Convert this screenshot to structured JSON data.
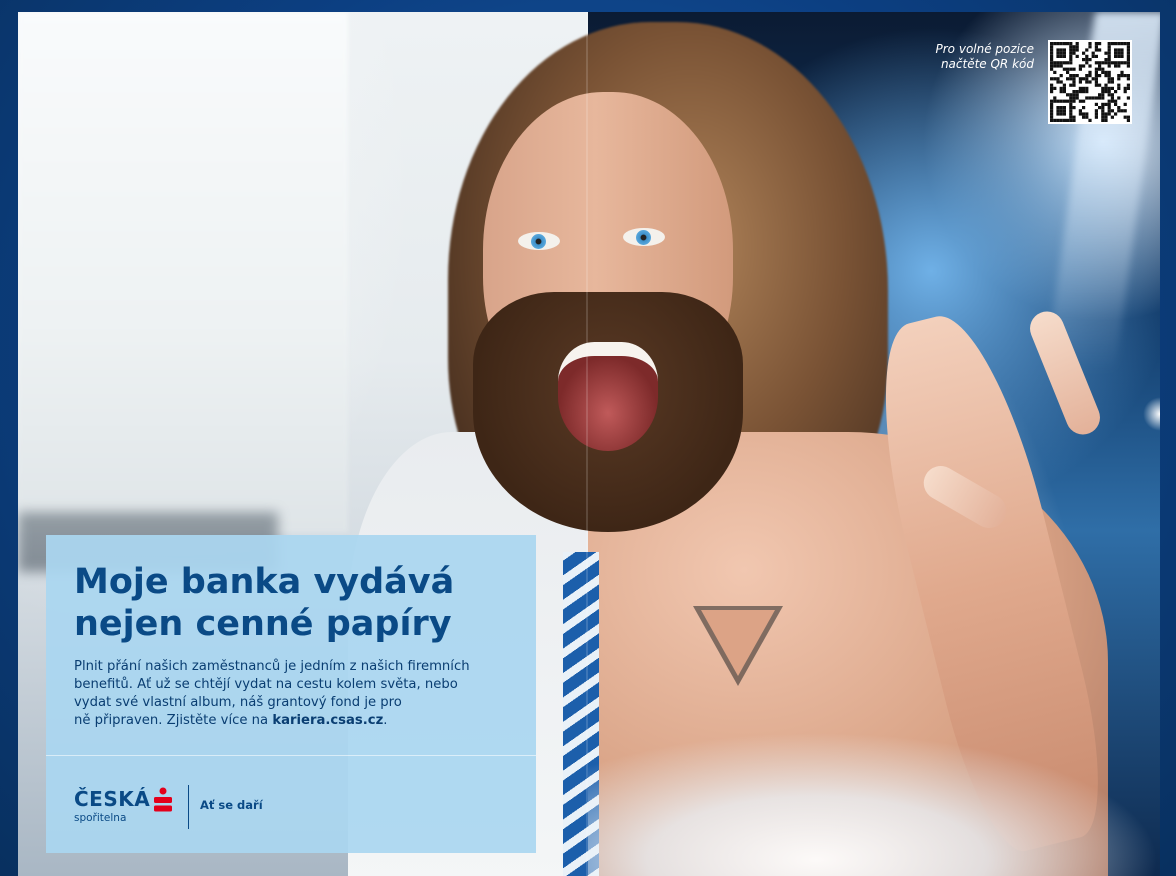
{
  "qr": {
    "label_line1": "Pro volné pozice",
    "label_line2": "načtěte QR kód",
    "icon": "qr-code-icon"
  },
  "panel": {
    "headline_line1": "Moje banka vydává",
    "headline_line2": "nejen cenné papíry",
    "body_line1": "Plnit přání našich zaměstnanců je jedním z našich firemních",
    "body_line2": "benefitů. Ať už se chtějí vydat na cestu kolem světa, nebo",
    "body_line3": "vydat své vlastní album, náš grantový fond je pro",
    "body_line4_prefix": "ně připraven. Zjistěte více na ",
    "body_link": "kariera.csas.cz",
    "body_line4_suffix": "."
  },
  "brand": {
    "name": "ČESKÁ",
    "sub": "spořitelna",
    "slogan": "Ať se daří",
    "logo_icon": "ceska-sporitelna-s-icon",
    "colors": {
      "primary": "#0a4a86",
      "accent": "#e3001b"
    }
  },
  "colors": {
    "frame": "#0c3f82",
    "panel": "#aad6f0",
    "headline": "#0a4a86"
  }
}
